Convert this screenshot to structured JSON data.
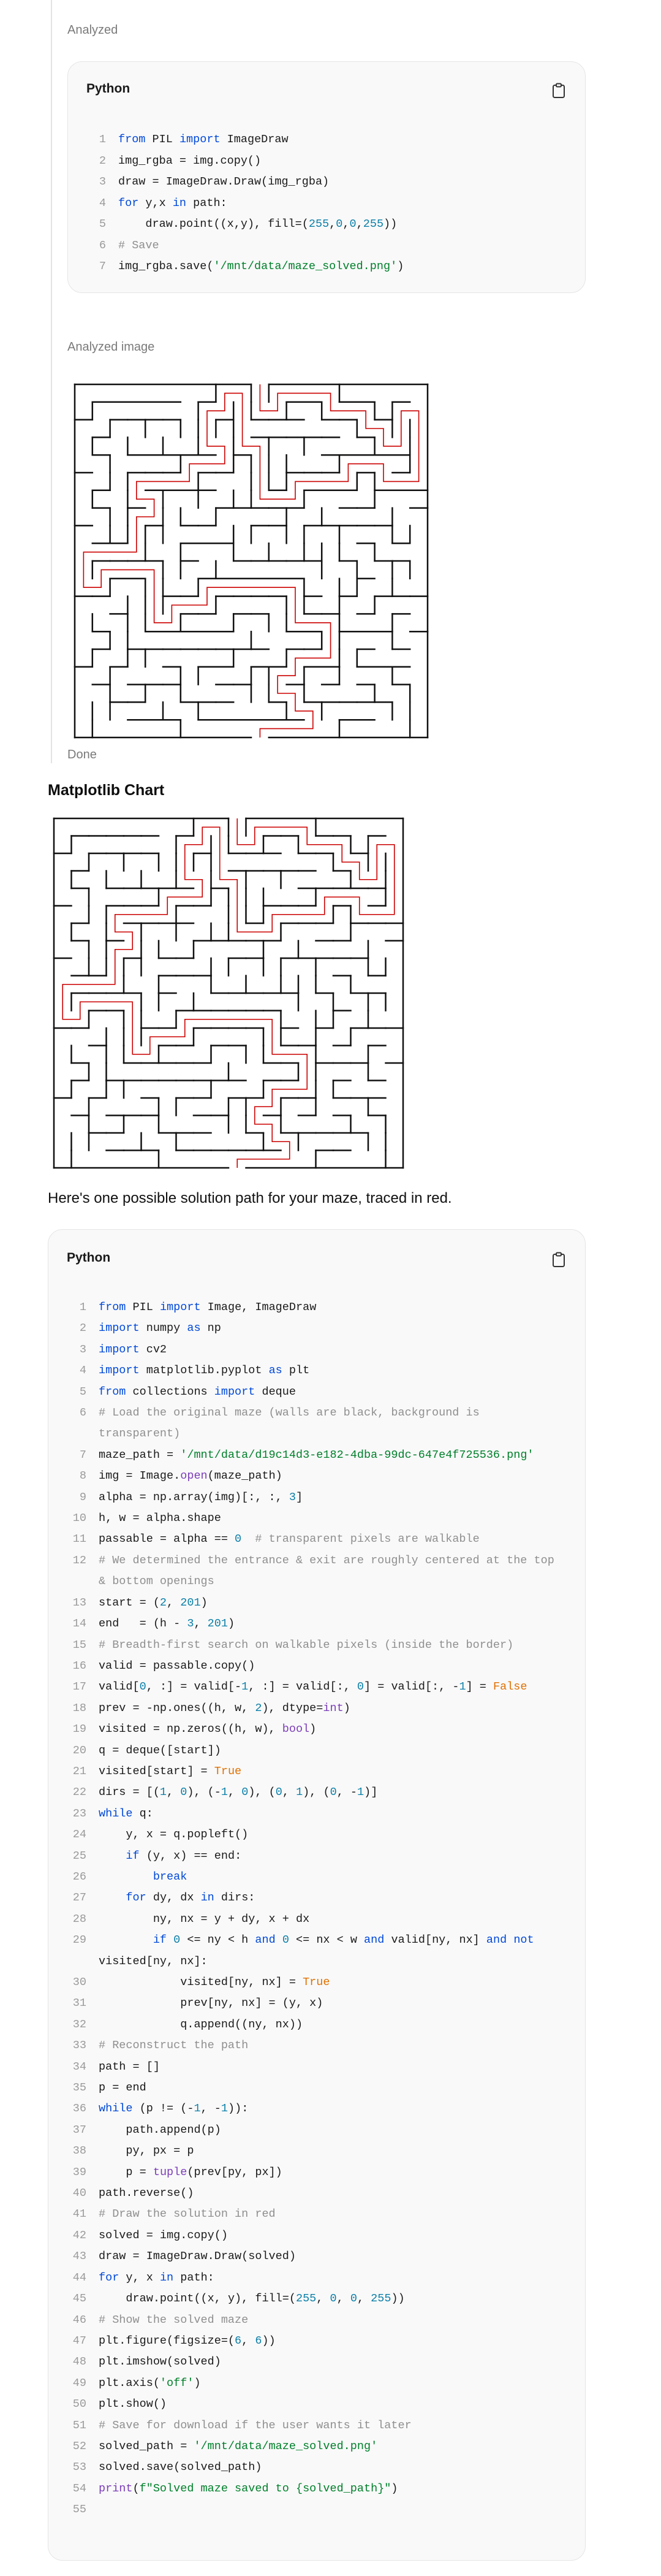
{
  "top_status": "Analyzed",
  "card1": {
    "language": "Python",
    "lines": [
      [
        [
          "kw",
          "from"
        ],
        [
          "p",
          " PIL "
        ],
        [
          "kw",
          "import"
        ],
        [
          "p",
          " ImageDraw"
        ]
      ],
      [
        [
          "p",
          "img_rgba = img.copy()"
        ]
      ],
      [
        [
          "p",
          "draw = ImageDraw.Draw(img_rgba)"
        ]
      ],
      [
        [
          "kw",
          "for"
        ],
        [
          "p",
          " y,x "
        ],
        [
          "kw",
          "in"
        ],
        [
          "p",
          " path:"
        ]
      ],
      [
        [
          "p",
          "    draw.point((x,y), fill=("
        ],
        [
          "numtok",
          "255"
        ],
        [
          "p",
          ","
        ],
        [
          "numtok",
          "0"
        ],
        [
          "p",
          ","
        ],
        [
          "numtok",
          "0"
        ],
        [
          "p",
          ","
        ],
        [
          "numtok",
          "255"
        ],
        [
          "p",
          "))"
        ]
      ],
      [
        [
          "cm",
          "# Save"
        ]
      ],
      [
        [
          "p",
          "img_rgba.save("
        ],
        [
          "str",
          "'/mnt/data/maze_solved.png'"
        ],
        [
          "p",
          ")"
        ]
      ]
    ]
  },
  "analyzed_image_label": "Analyzed image",
  "done_label": "Done",
  "chart_heading": "Matplotlib Chart",
  "description": "Here's one possible solution path for your maze, traced in red.",
  "card2": {
    "language": "Python",
    "lines": [
      [
        [
          "kw",
          "from"
        ],
        [
          "p",
          " PIL "
        ],
        [
          "kw",
          "import"
        ],
        [
          "p",
          " Image, ImageDraw"
        ]
      ],
      [
        [
          "kw",
          "import"
        ],
        [
          "p",
          " numpy "
        ],
        [
          "kw",
          "as"
        ],
        [
          "p",
          " np"
        ]
      ],
      [
        [
          "kw",
          "import"
        ],
        [
          "p",
          " cv2"
        ]
      ],
      [
        [
          "kw",
          "import"
        ],
        [
          "p",
          " matplotlib.pyplot "
        ],
        [
          "kw",
          "as"
        ],
        [
          "p",
          " plt"
        ]
      ],
      [
        [
          "kw",
          "from"
        ],
        [
          "p",
          " collections "
        ],
        [
          "kw",
          "import"
        ],
        [
          "p",
          " deque"
        ]
      ],
      [
        [
          "cm",
          "# Load the original maze (walls are black, background is transparent)"
        ]
      ],
      [
        [
          "p",
          "maze_path = "
        ],
        [
          "str",
          "'/mnt/data/d19c14d3-e182-4dba-99dc-647e4f725536.png'"
        ]
      ],
      [
        [
          "p",
          "img = Image."
        ],
        [
          "fn",
          "open"
        ],
        [
          "p",
          "(maze_path)"
        ]
      ],
      [
        [
          "p",
          "alpha = np.array(img)[:, :, "
        ],
        [
          "numtok",
          "3"
        ],
        [
          "p",
          "]"
        ]
      ],
      [
        [
          "p",
          "h, w = alpha.shape"
        ]
      ],
      [
        [
          "p",
          "passable = alpha == "
        ],
        [
          "numtok",
          "0"
        ],
        [
          "p",
          "  "
        ],
        [
          "cm",
          "# transparent pixels are walkable"
        ]
      ],
      [
        [
          "cm",
          "# We determined the entrance & exit are roughly centered at the top & bottom openings"
        ]
      ],
      [
        [
          "p",
          "start = ("
        ],
        [
          "numtok",
          "2"
        ],
        [
          "p",
          ", "
        ],
        [
          "numtok",
          "201"
        ],
        [
          "p",
          ")"
        ]
      ],
      [
        [
          "p",
          "end   = (h - "
        ],
        [
          "numtok",
          "3"
        ],
        [
          "p",
          ", "
        ],
        [
          "numtok",
          "201"
        ],
        [
          "p",
          ")"
        ]
      ],
      [
        [
          "cm",
          "# Breadth-first search on walkable pixels (inside the border)"
        ]
      ],
      [
        [
          "p",
          "valid = passable.copy()"
        ]
      ],
      [
        [
          "p",
          "valid["
        ],
        [
          "numtok",
          "0"
        ],
        [
          "p",
          ", :] = valid[-"
        ],
        [
          "numtok",
          "1"
        ],
        [
          "p",
          ", :] = valid[:, "
        ],
        [
          "numtok",
          "0"
        ],
        [
          "p",
          "] = valid[:, -"
        ],
        [
          "numtok",
          "1"
        ],
        [
          "p",
          "] = "
        ],
        [
          "const",
          "False"
        ]
      ],
      [
        [
          "p",
          "prev = -np.ones((h, w, "
        ],
        [
          "numtok",
          "2"
        ],
        [
          "p",
          "), dtype="
        ],
        [
          "fn",
          "int"
        ],
        [
          "p",
          ")"
        ]
      ],
      [
        [
          "p",
          "visited = np.zeros((h, w), "
        ],
        [
          "fn",
          "bool"
        ],
        [
          "p",
          ")"
        ]
      ],
      [
        [
          "p",
          "q = deque([start])"
        ]
      ],
      [
        [
          "p",
          "visited[start] = "
        ],
        [
          "const",
          "True"
        ]
      ],
      [
        [
          "p",
          "dirs = [("
        ],
        [
          "numtok",
          "1"
        ],
        [
          "p",
          ", "
        ],
        [
          "numtok",
          "0"
        ],
        [
          "p",
          "), (-"
        ],
        [
          "numtok",
          "1"
        ],
        [
          "p",
          ", "
        ],
        [
          "numtok",
          "0"
        ],
        [
          "p",
          "), ("
        ],
        [
          "numtok",
          "0"
        ],
        [
          "p",
          ", "
        ],
        [
          "numtok",
          "1"
        ],
        [
          "p",
          "), ("
        ],
        [
          "numtok",
          "0"
        ],
        [
          "p",
          ", -"
        ],
        [
          "numtok",
          "1"
        ],
        [
          "p",
          ")]"
        ]
      ],
      [
        [
          "kw",
          "while"
        ],
        [
          "p",
          " q:"
        ]
      ],
      [
        [
          "p",
          "    y, x = q.popleft()"
        ]
      ],
      [
        [
          "p",
          "    "
        ],
        [
          "kw",
          "if"
        ],
        [
          "p",
          " (y, x) == end:"
        ]
      ],
      [
        [
          "p",
          "        "
        ],
        [
          "kw",
          "break"
        ]
      ],
      [
        [
          "p",
          "    "
        ],
        [
          "kw",
          "for"
        ],
        [
          "p",
          " dy, dx "
        ],
        [
          "kw",
          "in"
        ],
        [
          "p",
          " dirs:"
        ]
      ],
      [
        [
          "p",
          "        ny, nx = y + dy, x + dx"
        ]
      ],
      [
        [
          "p",
          "        "
        ],
        [
          "kw",
          "if"
        ],
        [
          "p",
          " "
        ],
        [
          "numtok",
          "0"
        ],
        [
          "p",
          " <= ny < h "
        ],
        [
          "kw",
          "and"
        ],
        [
          "p",
          " "
        ],
        [
          "numtok",
          "0"
        ],
        [
          "p",
          " <= nx < w "
        ],
        [
          "kw",
          "and"
        ],
        [
          "p",
          " valid[ny, nx] "
        ],
        [
          "kw",
          "and"
        ],
        [
          "p",
          " "
        ],
        [
          "kw",
          "not"
        ],
        [
          "p",
          " visited[ny, nx]:"
        ]
      ],
      [
        [
          "p",
          "            visited[ny, nx] = "
        ],
        [
          "const",
          "True"
        ]
      ],
      [
        [
          "p",
          "            prev[ny, nx] = (y, x)"
        ]
      ],
      [
        [
          "p",
          "            q.append((ny, nx))"
        ]
      ],
      [
        [
          "cm",
          "# Reconstruct the path"
        ]
      ],
      [
        [
          "p",
          "path = []"
        ]
      ],
      [
        [
          "p",
          "p = end"
        ]
      ],
      [
        [
          "kw",
          "while"
        ],
        [
          "p",
          " (p != (-"
        ],
        [
          "numtok",
          "1"
        ],
        [
          "p",
          ", -"
        ],
        [
          "numtok",
          "1"
        ],
        [
          "p",
          "))"
        ],
        [
          "p",
          ":"
        ]
      ],
      [
        [
          "p",
          "    path.append(p)"
        ]
      ],
      [
        [
          "p",
          "    py, px = p"
        ]
      ],
      [
        [
          "p",
          "    p = "
        ],
        [
          "fn",
          "tuple"
        ],
        [
          "p",
          "(prev[py, px])"
        ]
      ],
      [
        [
          "p",
          "path.reverse()"
        ]
      ],
      [
        [
          "cm",
          "# Draw the solution in red"
        ]
      ],
      [
        [
          "p",
          "solved = img.copy()"
        ]
      ],
      [
        [
          "p",
          "draw = ImageDraw.Draw(solved)"
        ]
      ],
      [
        [
          "kw",
          "for"
        ],
        [
          "p",
          " y, x "
        ],
        [
          "kw",
          "in"
        ],
        [
          "p",
          " path:"
        ]
      ],
      [
        [
          "p",
          "    draw.point((x, y), fill=("
        ],
        [
          "numtok",
          "255"
        ],
        [
          "p",
          ", "
        ],
        [
          "numtok",
          "0"
        ],
        [
          "p",
          ", "
        ],
        [
          "numtok",
          "0"
        ],
        [
          "p",
          ", "
        ],
        [
          "numtok",
          "255"
        ],
        [
          "p",
          "))"
        ]
      ],
      [
        [
          "cm",
          "# Show the solved maze"
        ]
      ],
      [
        [
          "p",
          "plt.figure(figsize=("
        ],
        [
          "numtok",
          "6"
        ],
        [
          "p",
          ", "
        ],
        [
          "numtok",
          "6"
        ],
        [
          "p",
          "))"
        ]
      ],
      [
        [
          "p",
          "plt.imshow(solved)"
        ]
      ],
      [
        [
          "p",
          "plt.axis("
        ],
        [
          "str",
          "'off'"
        ],
        [
          "p",
          ")"
        ]
      ],
      [
        [
          "p",
          "plt.show()"
        ]
      ],
      [
        [
          "cm",
          "# Save for download if the user wants it later"
        ]
      ],
      [
        [
          "p",
          "solved_path = "
        ],
        [
          "str",
          "'/mnt/data/maze_solved.png'"
        ]
      ],
      [
        [
          "p",
          "solved.save(solved_path)"
        ]
      ],
      [
        [
          "fn",
          "print"
        ],
        [
          "p",
          "("
        ],
        [
          "str",
          "f\"Solved maze saved to {solved_path}\""
        ],
        [
          "p",
          ")"
        ]
      ],
      [
        [
          "p",
          ""
        ]
      ]
    ]
  },
  "icons": {
    "copy": "clipboard-icon",
    "maze": "maze-image"
  },
  "colors": {
    "solution": "#cc0000",
    "wall": "#111111"
  }
}
